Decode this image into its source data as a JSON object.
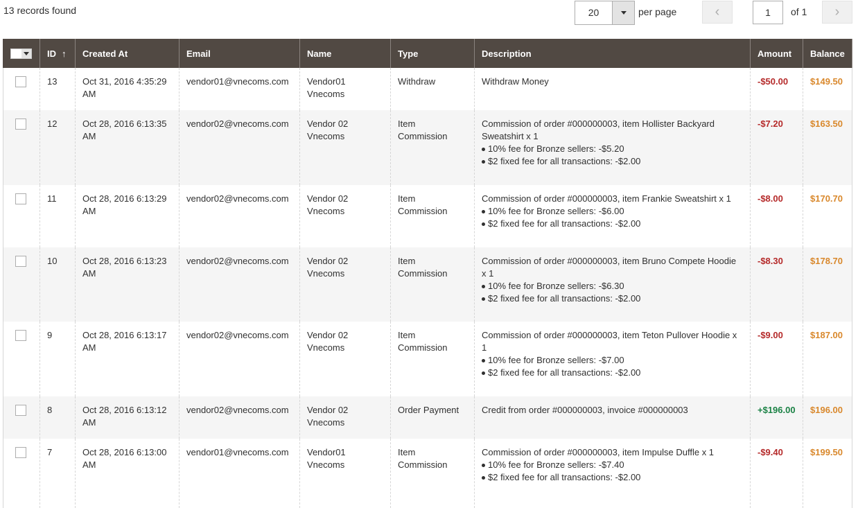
{
  "toolbar": {
    "records_found": "13 records found",
    "per_page_value": "20",
    "per_page_label": "per page",
    "prev_icon": "‹",
    "next_icon": "›",
    "current_page": "1",
    "page_total": "of 1"
  },
  "columns": {
    "id": "ID",
    "id_sort": "↑",
    "created_at": "Created At",
    "email": "Email",
    "name": "Name",
    "type": "Type",
    "description": "Description",
    "amount": "Amount",
    "balance": "Balance"
  },
  "colors": {
    "header_bg": "#514943",
    "negative": "#b52a2a",
    "positive": "#1b8245",
    "balance": "#d9882c"
  },
  "rows": [
    {
      "id": "13",
      "created_line1": "Oct 31, 2016 4:35:29",
      "created_line2": "AM",
      "email": "vendor01@vnecoms.com",
      "name_line1": "Vendor01",
      "name_line2": "Vnecoms",
      "type_line1": "Withdraw",
      "type_line2": "",
      "description": "Withdraw Money",
      "fees": [],
      "amount": "-$50.00",
      "amount_sign": "neg",
      "balance": "$149.50"
    },
    {
      "id": "12",
      "created_line1": "Oct 28, 2016 6:13:35",
      "created_line2": "AM",
      "email": "vendor02@vnecoms.com",
      "name_line1": "Vendor 02",
      "name_line2": "Vnecoms",
      "type_line1": "Item",
      "type_line2": "Commission",
      "description": "Commission of order #000000003, item Hollister Backyard Sweatshirt x 1",
      "fees": [
        "10% fee for Bronze sellers: -$5.20",
        "$2 fixed fee for all transactions: -$2.00"
      ],
      "amount": "-$7.20",
      "amount_sign": "neg",
      "balance": "$163.50"
    },
    {
      "id": "11",
      "created_line1": "Oct 28, 2016 6:13:29",
      "created_line2": "AM",
      "email": "vendor02@vnecoms.com",
      "name_line1": "Vendor 02",
      "name_line2": "Vnecoms",
      "type_line1": "Item",
      "type_line2": "Commission",
      "description": "Commission of order #000000003, item Frankie Sweatshirt x 1",
      "fees": [
        "10% fee for Bronze sellers: -$6.00",
        "$2 fixed fee for all transactions: -$2.00"
      ],
      "amount": "-$8.00",
      "amount_sign": "neg",
      "balance": "$170.70"
    },
    {
      "id": "10",
      "created_line1": "Oct 28, 2016 6:13:23",
      "created_line2": "AM",
      "email": "vendor02@vnecoms.com",
      "name_line1": "Vendor 02",
      "name_line2": "Vnecoms",
      "type_line1": "Item",
      "type_line2": "Commission",
      "description": "Commission of order #000000003, item Bruno Compete Hoodie x 1",
      "fees": [
        "10% fee for Bronze sellers: -$6.30",
        "$2 fixed fee for all transactions: -$2.00"
      ],
      "amount": "-$8.30",
      "amount_sign": "neg",
      "balance": "$178.70"
    },
    {
      "id": "9",
      "created_line1": "Oct 28, 2016 6:13:17",
      "created_line2": "AM",
      "email": "vendor02@vnecoms.com",
      "name_line1": "Vendor 02",
      "name_line2": "Vnecoms",
      "type_line1": "Item",
      "type_line2": "Commission",
      "description": "Commission of order #000000003, item Teton Pullover Hoodie x 1",
      "fees": [
        "10% fee for Bronze sellers: -$7.00",
        "$2 fixed fee for all transactions: -$2.00"
      ],
      "amount": "-$9.00",
      "amount_sign": "neg",
      "balance": "$187.00"
    },
    {
      "id": "8",
      "created_line1": "Oct 28, 2016 6:13:12",
      "created_line2": "AM",
      "email": "vendor02@vnecoms.com",
      "name_line1": "Vendor 02",
      "name_line2": "Vnecoms",
      "type_line1": "Order Payment",
      "type_line2": "",
      "description": "Credit from order #000000003, invoice #000000003",
      "fees": [],
      "amount": "+$196.00",
      "amount_sign": "pos",
      "balance": "$196.00"
    },
    {
      "id": "7",
      "created_line1": "Oct 28, 2016 6:13:00",
      "created_line2": "AM",
      "email": "vendor01@vnecoms.com",
      "name_line1": "Vendor01",
      "name_line2": "Vnecoms",
      "type_line1": "Item",
      "type_line2": "Commission",
      "description": "Commission of order #000000003, item Impulse Duffle x 1",
      "fees": [
        "10% fee for Bronze sellers: -$7.40",
        "$2 fixed fee for all transactions: -$2.00"
      ],
      "amount": "-$9.40",
      "amount_sign": "neg",
      "balance": "$199.50"
    }
  ]
}
